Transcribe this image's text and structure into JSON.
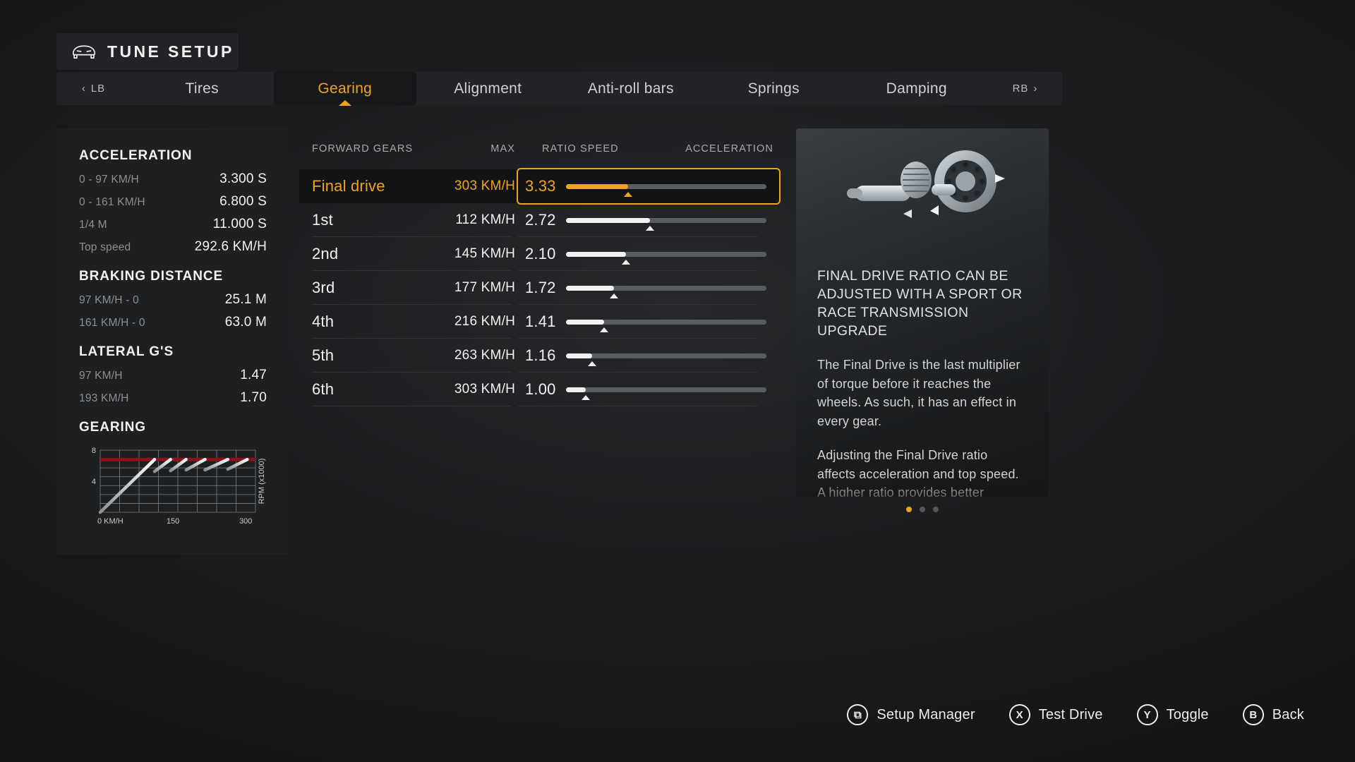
{
  "header": {
    "title": "TUNE SETUP",
    "icon": "car-icon"
  },
  "tabs": {
    "prev": {
      "label": "LB",
      "icon": "chevron-left-icon"
    },
    "next": {
      "label": "RB",
      "icon": "chevron-right-icon"
    },
    "items": [
      {
        "label": "Tires",
        "active": false
      },
      {
        "label": "Gearing",
        "active": true
      },
      {
        "label": "Alignment",
        "active": false
      },
      {
        "label": "Anti-roll bars",
        "active": false
      },
      {
        "label": "Springs",
        "active": false
      },
      {
        "label": "Damping",
        "active": false
      }
    ]
  },
  "stats": {
    "sections": [
      {
        "title": "ACCELERATION",
        "rows": [
          {
            "label": "0 - 97 KM/H",
            "value": "3.300 S"
          },
          {
            "label": "0 - 161 KM/H",
            "value": "6.800 S"
          },
          {
            "label": "1/4 M",
            "value": "11.000 S"
          },
          {
            "label": "Top speed",
            "value": "292.6 KM/H"
          }
        ]
      },
      {
        "title": "BRAKING DISTANCE",
        "rows": [
          {
            "label": "97 KM/H - 0",
            "value": "25.1 M"
          },
          {
            "label": "161 KM/H - 0",
            "value": "63.0 M"
          }
        ]
      },
      {
        "title": "LATERAL G'S",
        "rows": [
          {
            "label": "97 KM/H",
            "value": "1.47"
          },
          {
            "label": "193 KM/H",
            "value": "1.70"
          }
        ]
      }
    ],
    "gearing_title": "GEARING"
  },
  "chart_data": {
    "type": "line",
    "title": "GEARING",
    "xlabel": "KM/H",
    "ylabel": "RPM (x1000)",
    "xlim": [
      0,
      320
    ],
    "ylim": [
      0,
      8
    ],
    "xticks": [
      0,
      150,
      300
    ],
    "xtick_labels": [
      "0 KM/H",
      "150",
      "300"
    ],
    "yticks": [
      4,
      8
    ],
    "ytick_labels": [
      "4",
      "8"
    ],
    "grid": true,
    "redline": 6.8,
    "redline_color": "#8d1118",
    "series": [
      {
        "name": "1st",
        "x": [
          0,
          112
        ],
        "y": [
          0.0,
          6.8
        ]
      },
      {
        "name": "2nd",
        "x": [
          112,
          145
        ],
        "y": [
          5.25,
          6.8
        ]
      },
      {
        "name": "3rd",
        "x": [
          145,
          177
        ],
        "y": [
          5.35,
          6.8
        ]
      },
      {
        "name": "4th",
        "x": [
          177,
          216
        ],
        "y": [
          5.45,
          6.8
        ]
      },
      {
        "name": "5th",
        "x": [
          216,
          263
        ],
        "y": [
          5.45,
          6.8
        ]
      },
      {
        "name": "6th",
        "x": [
          263,
          303
        ],
        "y": [
          5.55,
          6.8
        ]
      }
    ]
  },
  "gear_table": {
    "headers": {
      "gears": "FORWARD GEARS",
      "max": "MAX",
      "ratio": "RATIO",
      "speed": "SPEED",
      "acceleration": "ACCELERATION"
    },
    "rows": [
      {
        "name": "Final drive",
        "max": "303 KM/H",
        "ratio": "3.33",
        "fill": 31,
        "selected": true
      },
      {
        "name": "1st",
        "max": "112 KM/H",
        "ratio": "2.72",
        "fill": 42,
        "selected": false
      },
      {
        "name": "2nd",
        "max": "145 KM/H",
        "ratio": "2.10",
        "fill": 30,
        "selected": false
      },
      {
        "name": "3rd",
        "max": "177 KM/H",
        "ratio": "1.72",
        "fill": 24,
        "selected": false
      },
      {
        "name": "4th",
        "max": "216 KM/H",
        "ratio": "1.41",
        "fill": 19,
        "selected": false
      },
      {
        "name": "5th",
        "max": "263 KM/H",
        "ratio": "1.16",
        "fill": 13,
        "selected": false
      },
      {
        "name": "6th",
        "max": "303 KM/H",
        "ratio": "1.00",
        "fill": 10,
        "selected": false
      }
    ]
  },
  "info": {
    "image_name": "differential-gear-image",
    "heading": "FINAL DRIVE RATIO CAN BE ADJUSTED WITH A SPORT OR RACE TRANSMISSION UPGRADE",
    "paragraph1": "The Final Drive is the last multiplier of torque before it reaches the wheels. As such, it has an effect in every gear.",
    "paragraph2": "Adjusting the Final Drive ratio affects acceleration and top speed. A higher ratio provides better acceleration while a",
    "page_dots": 3,
    "active_dot": 0
  },
  "buttons": [
    {
      "glyph": "⧉",
      "label": "Setup Manager",
      "name": "setup-manager"
    },
    {
      "glyph": "X",
      "label": "Test Drive",
      "name": "test-drive"
    },
    {
      "glyph": "Y",
      "label": "Toggle",
      "name": "toggle"
    },
    {
      "glyph": "B",
      "label": "Back",
      "name": "back"
    }
  ],
  "colors": {
    "accent": "#f0a31e",
    "panel": "#1d1f21",
    "redline": "#8d1118"
  }
}
